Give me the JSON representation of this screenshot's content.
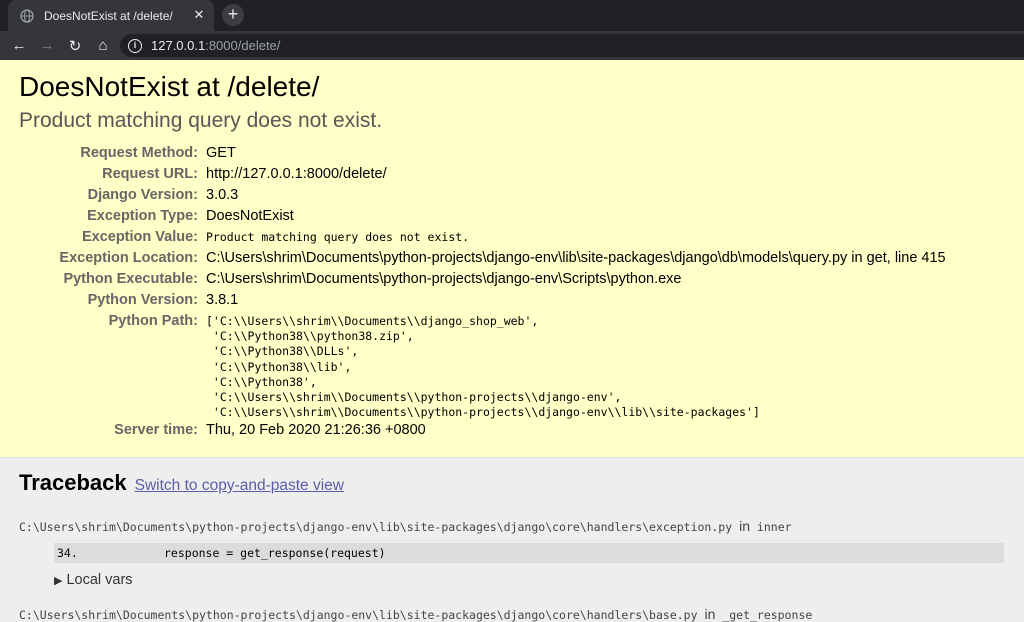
{
  "browser": {
    "tab_title": "DoesNotExist at /delete/",
    "tab_close": "✕",
    "new_tab": "+",
    "url_host": "127.0.0.1",
    "url_path": ":8000/delete/"
  },
  "error": {
    "title": "DoesNotExist at /delete/",
    "exception_value": "Product matching query does not exist."
  },
  "meta": {
    "request_method_label": "Request Method:",
    "request_method": "GET",
    "request_url_label": "Request URL:",
    "request_url": "http://127.0.0.1:8000/delete/",
    "django_version_label": "Django Version:",
    "django_version": "3.0.3",
    "exception_type_label": "Exception Type:",
    "exception_type": "DoesNotExist",
    "exception_value_label": "Exception Value:",
    "exception_value": "Product matching query does not exist.",
    "exception_location_label": "Exception Location:",
    "exception_location": "C:\\Users\\shrim\\Documents\\python-projects\\django-env\\lib\\site-packages\\django\\db\\models\\query.py in get, line 415",
    "python_executable_label": "Python Executable:",
    "python_executable": "C:\\Users\\shrim\\Documents\\python-projects\\django-env\\Scripts\\python.exe",
    "python_version_label": "Python Version:",
    "python_version": "3.8.1",
    "python_path_label": "Python Path:",
    "python_path": "['C:\\\\Users\\\\shrim\\\\Documents\\\\django_shop_web',\n 'C:\\\\Python38\\\\python38.zip',\n 'C:\\\\Python38\\\\DLLs',\n 'C:\\\\Python38\\\\lib',\n 'C:\\\\Python38',\n 'C:\\\\Users\\\\shrim\\\\Documents\\\\python-projects\\\\django-env',\n 'C:\\\\Users\\\\shrim\\\\Documents\\\\python-projects\\\\django-env\\\\lib\\\\site-packages']",
    "server_time_label": "Server time:",
    "server_time": "Thu, 20 Feb 2020 21:26:36 +0800"
  },
  "traceback": {
    "heading": "Traceback",
    "switch_link": "Switch to copy-and-paste view",
    "frame1_file": "C:\\Users\\shrim\\Documents\\python-projects\\django-env\\lib\\site-packages\\django\\core\\handlers\\exception.py",
    "frame1_in": "in",
    "frame1_func": "inner",
    "frame1_lineno": "34.",
    "frame1_code": "response = get_response(request)",
    "local_vars": "Local vars",
    "frame2_file": "C:\\Users\\shrim\\Documents\\python-projects\\django-env\\lib\\site-packages\\django\\core\\handlers\\base.py",
    "frame2_in": "in",
    "frame2_func": "_get_response"
  }
}
